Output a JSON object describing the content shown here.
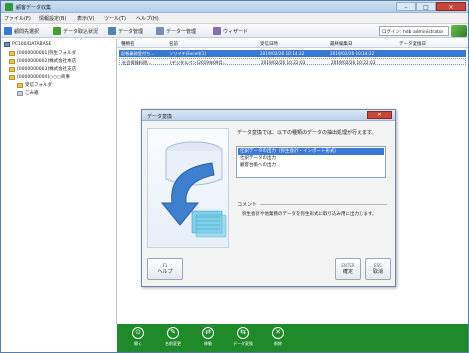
{
  "window": {
    "title": "顧客データ収集",
    "controls": {
      "minimize": "–",
      "maximize": "□",
      "close": "✕"
    }
  },
  "menubar": [
    "ファイル(F)",
    "情報設定(B)",
    "表示(V)",
    "ツール(T)",
    "ヘルプ(H)"
  ],
  "toolbar": {
    "items": [
      {
        "label": "顧問先選択",
        "icon": "client-select-icon",
        "color": "#3a78d6"
      },
      {
        "label": "データ取込状況",
        "icon": "import-status-icon",
        "color": "#4a9a3a"
      },
      {
        "label": "データ管理",
        "icon": "data-manage-icon",
        "color": "#5b7fb0"
      },
      {
        "label": "データ一管理",
        "icon": "data-list-icon",
        "color": "#7a8fb0"
      },
      {
        "label": "ウィザード",
        "icon": "wizard-icon",
        "color": "#8a6fb0"
      }
    ],
    "login_text": "ログイン: hdb administrator"
  },
  "tree": {
    "nodes": [
      {
        "label": "PC100/DATABASE",
        "icon": "computer-icon",
        "depth": 0
      },
      {
        "label": "[0000000001]弥生フォルダ",
        "icon": "folder-icon",
        "depth": 1
      },
      {
        "label": "[0000000002]株式会社本店",
        "icon": "folder-icon",
        "depth": 1
      },
      {
        "label": "[0000000003]株式会社支店",
        "icon": "folder-icon",
        "depth": 1
      },
      {
        "label": "[0000000004]○○○商事",
        "icon": "folder-icon",
        "depth": 1
      },
      {
        "label": "受信フォルダ",
        "icon": "folder-icon",
        "depth": 2
      },
      {
        "label": "ごみ箱",
        "icon": "trash-icon",
        "depth": 2
      }
    ]
  },
  "list": {
    "columns": [
      "種類名",
      "名前",
      "受信日時",
      "最終編集日",
      "データ変換日"
    ],
    "rows": [
      {
        "type": "記帳業務受付ち…",
        "name": "ソリマチ(Excel)(1)",
        "received": "2019/02/26 10:14:22",
        "edited": "2019/02/26 10:14:22",
        "converted": "",
        "selected": true
      },
      {
        "type": "社会保険料明…",
        "name": "(デジタルペン)2019年09月…",
        "received": "2019/02/26 10:22:03",
        "edited": "2019/02/26 10:22:03",
        "converted": "",
        "selected": false
      }
    ]
  },
  "bottom_actions": [
    {
      "label": "開く",
      "icon": "open-icon",
      "glyph": "⊙"
    },
    {
      "label": "名前変更",
      "icon": "rename-icon",
      "glyph": "✎"
    },
    {
      "label": "移動",
      "icon": "move-icon",
      "glyph": "⇄"
    },
    {
      "label": "データ変換",
      "icon": "convert-icon",
      "glyph": "⇆"
    },
    {
      "label": "削除",
      "icon": "delete-icon",
      "glyph": "✕"
    }
  ],
  "dialog": {
    "title": "データ変換",
    "close": "✕",
    "instruction": "データ変換では、以下の種類のデータの抽出処理が行えます。",
    "options": [
      {
        "label": "仕訳データの出力（弥生会計・インポート形式）",
        "selected": true
      },
      {
        "label": "仕訳データの出力",
        "selected": false
      },
      {
        "label": "顧客台帳への出力",
        "selected": false
      }
    ],
    "comment_label": "コメント",
    "comment_text": "弥生会計や他業務のデータを弥生形式に取り込み用に出力します。",
    "buttons": {
      "help_key": "F1",
      "help": "ヘルプ",
      "ok_key": "ENTER",
      "ok": "確定",
      "cancel_key": "ESC",
      "cancel": "取消"
    }
  }
}
